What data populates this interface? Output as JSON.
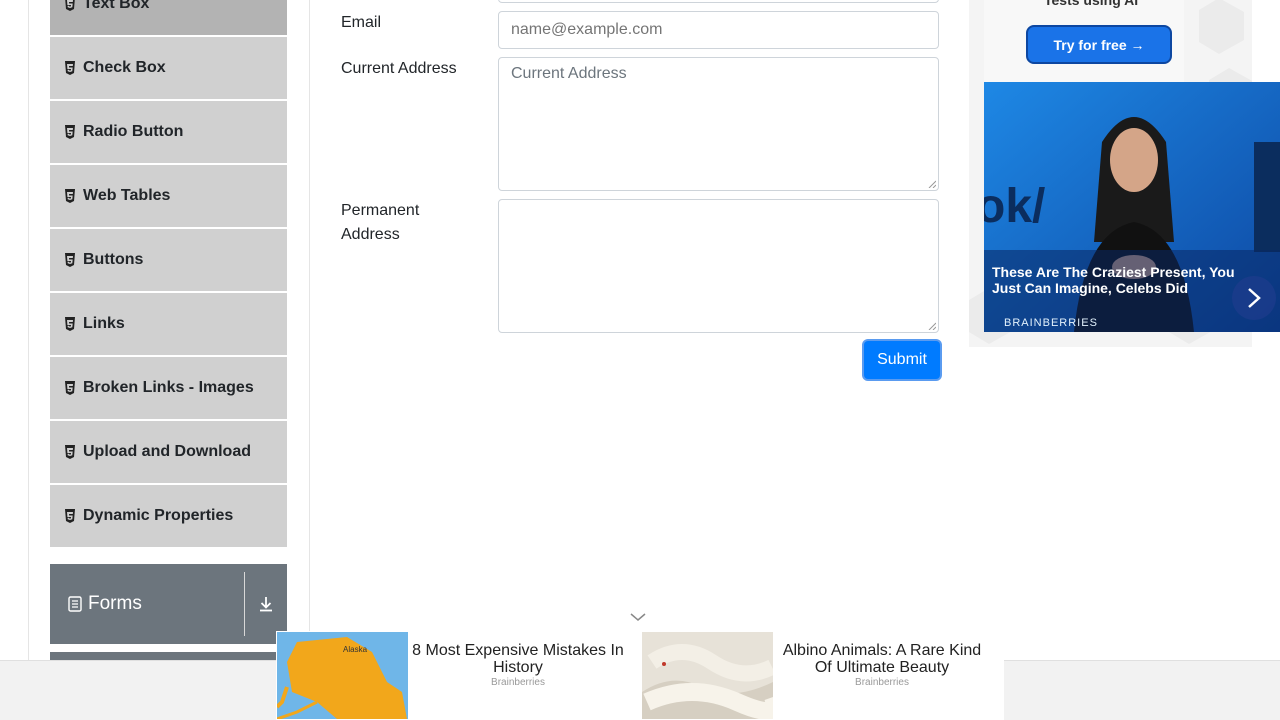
{
  "sidebar": {
    "items": [
      {
        "label": "Text Box",
        "active": true
      },
      {
        "label": "Check Box"
      },
      {
        "label": "Radio Button"
      },
      {
        "label": "Web Tables"
      },
      {
        "label": "Buttons"
      },
      {
        "label": "Links"
      },
      {
        "label": "Broken Links - Images"
      },
      {
        "label": "Upload and Download"
      },
      {
        "label": "Dynamic Properties"
      }
    ],
    "group": {
      "label": "Forms",
      "icon": "document-icon",
      "toggle_icon": "download-arrow-icon"
    }
  },
  "form": {
    "email_label": "Email",
    "email_placeholder": "name@example.com",
    "current_address_label": "Current Address",
    "current_address_placeholder": "Current Address",
    "permanent_address_label": "Permanent Address",
    "submit_label": "Submit"
  },
  "ad_right": {
    "top_text": "Tests using AI",
    "cta_label": "Try for free →",
    "caption": "These Are The Craziest Present, You Just Can Imagine, Celebs Did",
    "brand": "BRAINBERRIES",
    "next_icon": "chevron-right-icon",
    "accent": "#1a73e8"
  },
  "ad_bottom": {
    "collapse_icon": "chevron-down-icon",
    "items": [
      {
        "title": "8 Most Expensive Mistakes In History",
        "source": "Brainberries"
      },
      {
        "title": "Albino Animals: A Rare Kind Of Ultimate Beauty",
        "source": "Brainberries"
      }
    ]
  },
  "colors": {
    "sidebar_item": "#d0d0d0",
    "group_header": "#6c757d",
    "primary": "#007bff"
  }
}
